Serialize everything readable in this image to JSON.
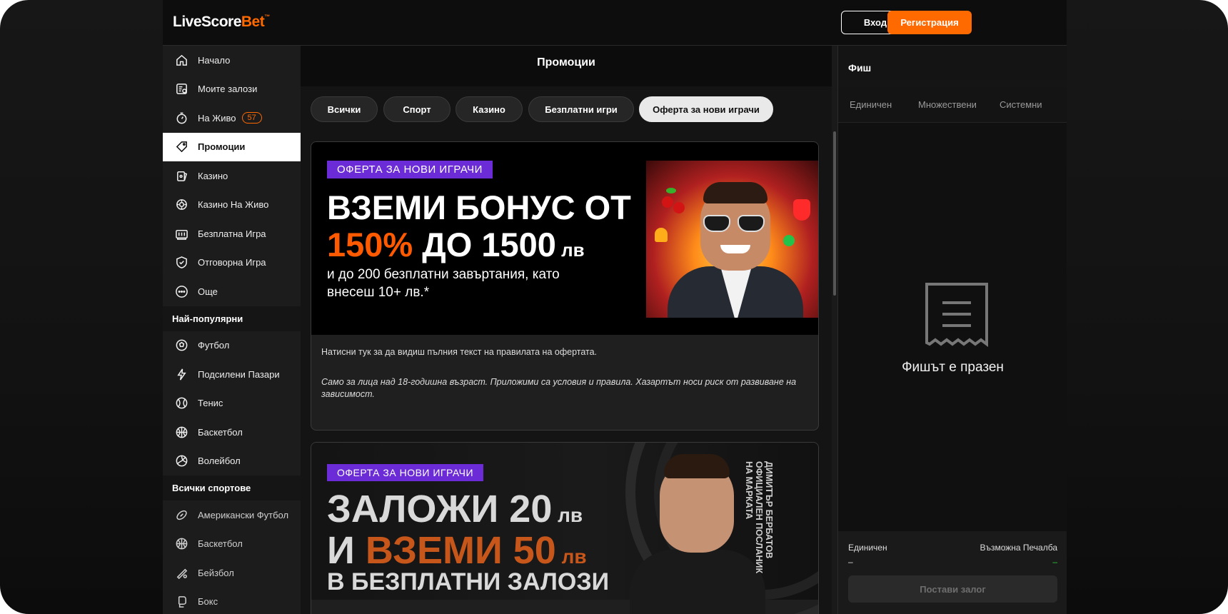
{
  "header": {
    "logo_main": "LiveScore",
    "logo_accent": "Bet",
    "logo_mark": "™",
    "login_label": "Вход",
    "register_label": "Регистрация"
  },
  "sidebar": {
    "items": [
      {
        "label": "Начало",
        "icon": "home-icon"
      },
      {
        "label": "Моите залози",
        "icon": "my-bets-icon"
      },
      {
        "label": "На Живо",
        "icon": "live-stopwatch-icon",
        "badge": "57"
      },
      {
        "label": "Промоции",
        "icon": "promo-tag-icon",
        "active": true
      },
      {
        "label": "Казино",
        "icon": "cards-icon"
      },
      {
        "label": "Казино На Живо",
        "icon": "chip-icon"
      },
      {
        "label": "Безплатна Игра",
        "icon": "slot-machine-icon"
      },
      {
        "label": "Отговорна Игра",
        "icon": "shield-check-icon"
      },
      {
        "label": "Още",
        "icon": "more-dots-icon"
      }
    ],
    "popular_heading": "Най-популярни",
    "popular": [
      {
        "label": "Футбол",
        "icon": "football-icon"
      },
      {
        "label": "Подсилени Пазари",
        "icon": "boost-icon"
      },
      {
        "label": "Тенис",
        "icon": "tennis-ball-icon"
      },
      {
        "label": "Баскетбол",
        "icon": "basketball-icon"
      },
      {
        "label": "Волейбол",
        "icon": "volleyball-icon"
      }
    ],
    "all_heading": "Всички спортове",
    "all": [
      {
        "label": "Американски Футбол",
        "icon": "american-football-icon"
      },
      {
        "label": "Баскетбол",
        "icon": "basketball-icon"
      },
      {
        "label": "Бейзбол",
        "icon": "baseball-bat-icon"
      },
      {
        "label": "Бокс",
        "icon": "boxing-glove-icon"
      }
    ]
  },
  "main": {
    "title": "Промоции",
    "tabs": [
      {
        "label": "Всички"
      },
      {
        "label": "Спорт"
      },
      {
        "label": "Казино"
      },
      {
        "label": "Безплатни игри"
      },
      {
        "label": "Оферта за нови играчи",
        "active": true
      }
    ],
    "promo1": {
      "ribbon": "ОФЕРТА ЗА НОВИ ИГРАЧИ",
      "line1": "ВЗЕМИ БОНУС ОТ",
      "line2_accent": "150%",
      "line2_rest": " ДО 1500",
      "line2_unit": " лв",
      "sub1": "и до 200 безплатни завъртания, като",
      "sub2": "внесеш 10+ лв.*",
      "terms": "Натисни тук за да видиш пълния текст на правилата на офертата.",
      "disclaimer1": "Само за лица над 18-годишна възраст. Приложими са условия и правила. Хазартът носи риск от развиване на",
      "disclaimer2": "зависимост."
    },
    "promo2": {
      "ribbon": "ОФЕРТА ЗА НОВИ ИГРАЧИ",
      "line1": "ЗАЛОЖИ 20",
      "line1_unit": " лв",
      "line2_plain": "И ",
      "line2_accent": "ВЗЕМИ 50",
      "line2_unit": " лв",
      "line3": "В БЕЗПЛАТНИ ЗАЛОЗИ",
      "vertical1": "ДИМИТЪР БЕРБАТОВ",
      "vertical2": "ОФИЦИАЛЕН ПОСЛАНИК",
      "vertical3": "НА МАРКАТА"
    }
  },
  "betslip": {
    "title": "Фиш",
    "tabs": [
      "Единичен",
      "Множествени",
      "Системни"
    ],
    "empty": "Фишът е празен",
    "footer_left": "Единичен",
    "footer_right": "Възможна Печалба",
    "dash_left": "–",
    "dash_right": "–",
    "place_bet": "Постави залог"
  },
  "colors": {
    "accent": "#ff6a00",
    "ribbon": "#6b2bd6",
    "background": "#101010"
  }
}
